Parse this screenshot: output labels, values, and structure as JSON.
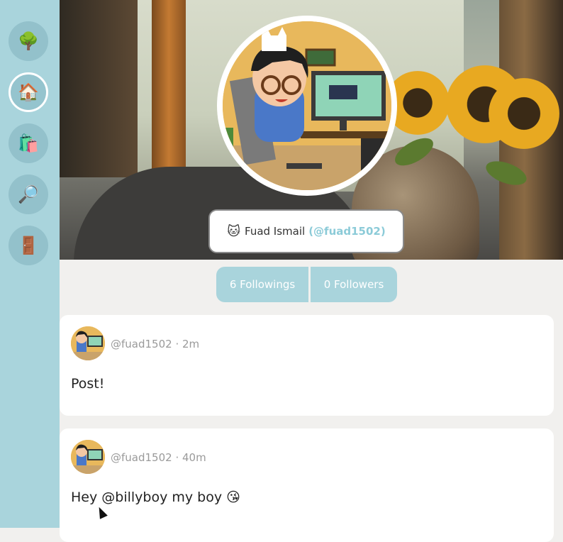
{
  "sidebar": {
    "items": [
      {
        "name": "tree",
        "icon": "🌳"
      },
      {
        "name": "home",
        "icon": "🏠",
        "active": true
      },
      {
        "name": "shopping",
        "icon": "🛍️"
      },
      {
        "name": "search",
        "icon": "🔎"
      },
      {
        "name": "logout",
        "icon": "🚪"
      }
    ]
  },
  "profile": {
    "emoji": "🐱",
    "display_name": "Fuad Ismail",
    "handle": "(@fuad1502)"
  },
  "stats": {
    "followings_label": "6 Followings",
    "followers_label": "0 Followers"
  },
  "posts": [
    {
      "meta": "@fuad1502 · 2m",
      "body": "Post!"
    },
    {
      "meta": "@fuad1502 · 40m",
      "body": "Hey @billyboy my boy 😘"
    }
  ],
  "colors": {
    "sidebar": "#a9d4dc",
    "accent": "#8ccbd8",
    "page_bg": "#f1f0ee"
  }
}
